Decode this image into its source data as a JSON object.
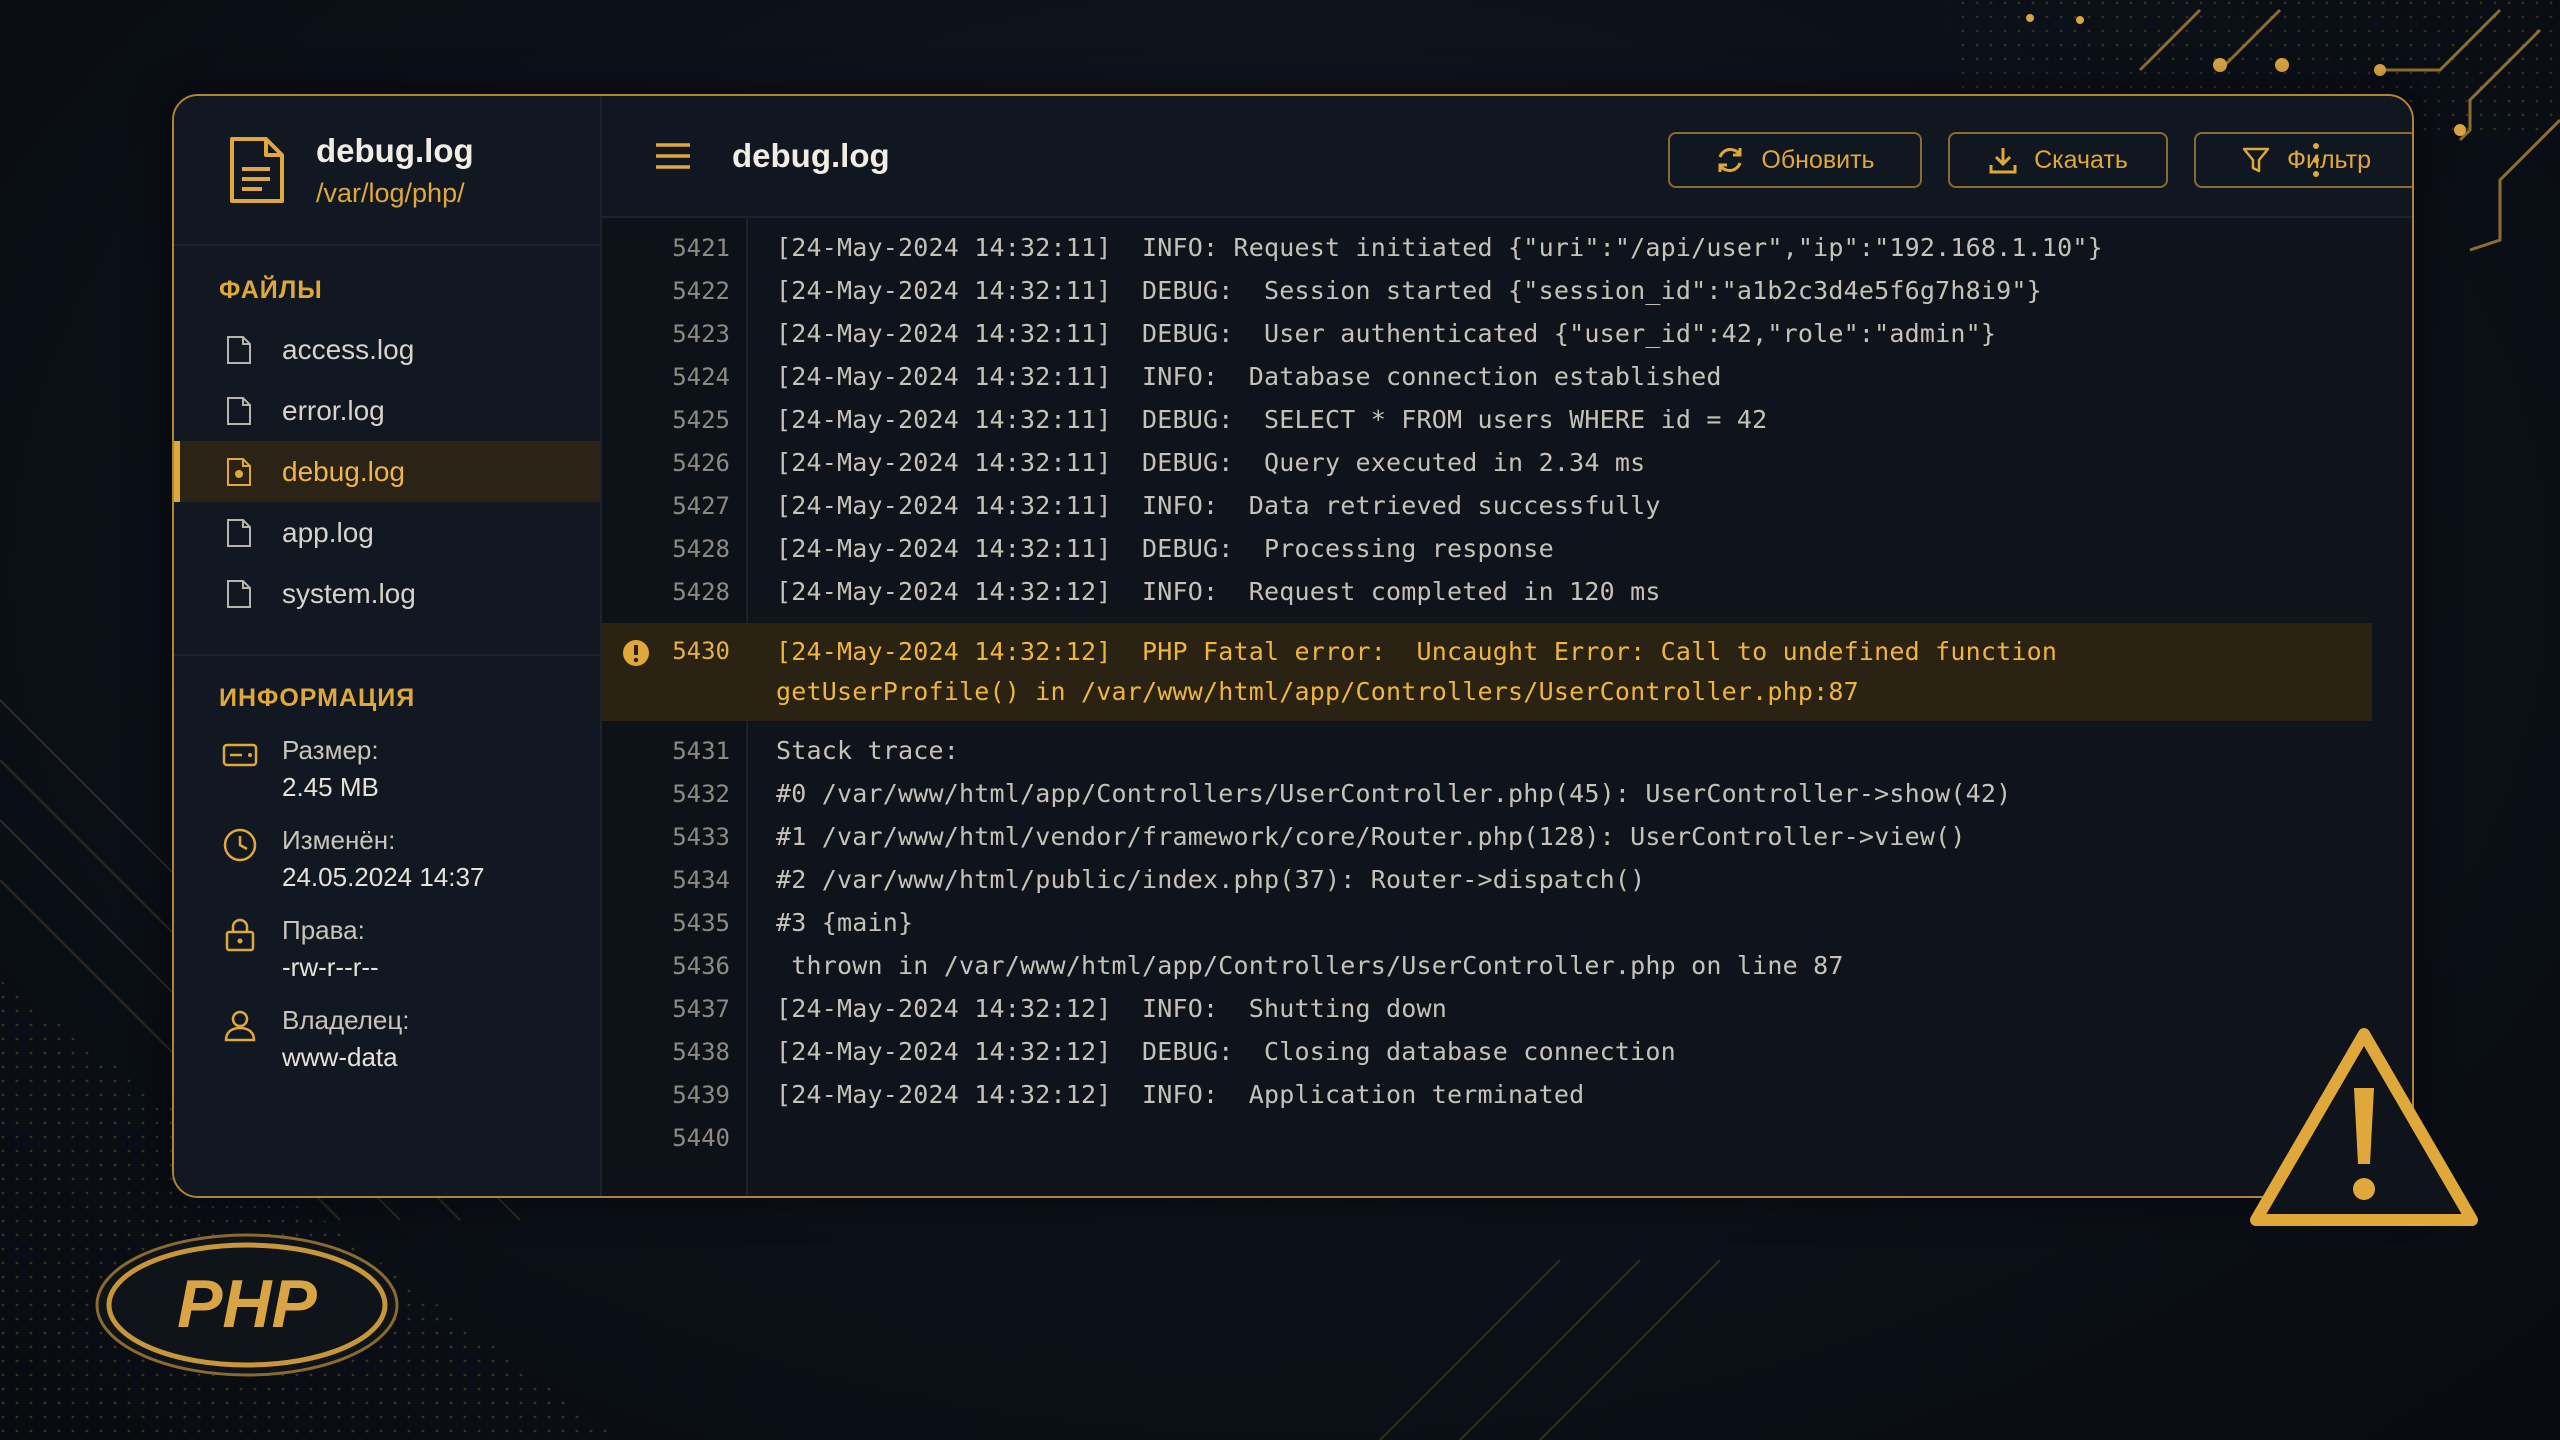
{
  "sidebar": {
    "file_name": "debug.log",
    "file_path": "/var/log/php/",
    "files_title": "ФАЙЛЫ",
    "files": [
      {
        "label": "access.log"
      },
      {
        "label": "error.log"
      },
      {
        "label": "debug.log"
      },
      {
        "label": "app.log"
      },
      {
        "label": "system.log"
      }
    ],
    "active_file": "debug.log",
    "info_title": "ИНФОРМАЦИЯ",
    "info": [
      {
        "label": "Размер:",
        "value": "2.45 MB",
        "icon": "drive-icon"
      },
      {
        "label": "Изменён:",
        "value": "24.05.2024 14:37",
        "icon": "clock-icon"
      },
      {
        "label": "Права:",
        "value": "-rw-r--r--",
        "icon": "lock-icon"
      },
      {
        "label": "Владелец:",
        "value": "www-data",
        "icon": "user-icon"
      }
    ]
  },
  "topbar": {
    "title": "debug.log",
    "refresh_label": "Обновить",
    "download_label": "Скачать",
    "filter_label": "Фильтр"
  },
  "log": {
    "lines_before": [
      {
        "num": "5421",
        "text": "[24-May-2024 14:32:11]  INFO: Request initiated {\"uri\":\"/api/user\",\"ip\":\"192.168.1.10\"}"
      },
      {
        "num": "5422",
        "text": "[24-May-2024 14:32:11]  DEBUG:  Session started {\"session_id\":\"a1b2c3d4e5f6g7h8i9\"}"
      },
      {
        "num": "5423",
        "text": "[24-May-2024 14:32:11]  DEBUG:  User authenticated {\"user_id\":42,\"role\":\"admin\"}"
      },
      {
        "num": "5424",
        "text": "[24-May-2024 14:32:11]  INFO:  Database connection established"
      },
      {
        "num": "5425",
        "text": "[24-May-2024 14:32:11]  DEBUG:  SELECT * FROM users WHERE id = 42"
      },
      {
        "num": "5426",
        "text": "[24-May-2024 14:32:11]  DEBUG:  Query executed in 2.34 ms"
      },
      {
        "num": "5427",
        "text": "[24-May-2024 14:32:11]  INFO:  Data retrieved successfully"
      },
      {
        "num": "5428",
        "text": "[24-May-2024 14:32:11]  DEBUG:  Processing response"
      },
      {
        "num": "5428",
        "text": "[24-May-2024 14:32:12]  INFO:  Request completed in 120 ms"
      }
    ],
    "error_line": {
      "num": "5430",
      "text_1": "[24-May-2024 14:32:12]  PHP Fatal error:  Uncaught Error: Call to undefined function",
      "text_2": "getUserProfile() in /var/www/html/app/Controllers/UserController.php:87"
    },
    "lines_after": [
      {
        "num": "5431",
        "text": "Stack trace:"
      },
      {
        "num": "5432",
        "text": "#0 /var/www/html/app/Controllers/UserController.php(45): UserController->show(42)"
      },
      {
        "num": "5433",
        "text": "#1 /var/www/html/vendor/framework/core/Router.php(128): UserController->view()"
      },
      {
        "num": "5434",
        "text": "#2 /var/www/html/public/index.php(37): Router->dispatch()"
      },
      {
        "num": "5435",
        "text": "#3 {main}"
      },
      {
        "num": "5436",
        "text": " thrown in /var/www/html/app/Controllers/UserController.php on line 87"
      },
      {
        "num": "5437",
        "text": "[24-May-2024 14:32:12]  INFO:  Shutting down"
      },
      {
        "num": "5438",
        "text": "[24-May-2024 14:32:12]  DEBUG:  Closing database connection"
      },
      {
        "num": "5439",
        "text": "[24-May-2024 14:32:12]  INFO:  Application terminated"
      },
      {
        "num": "5440",
        "text": ""
      }
    ]
  },
  "logo_text": "PHP",
  "colors": {
    "accent": "#e0a83a",
    "background": "#0f141c",
    "error_bg": "#2a2212"
  }
}
